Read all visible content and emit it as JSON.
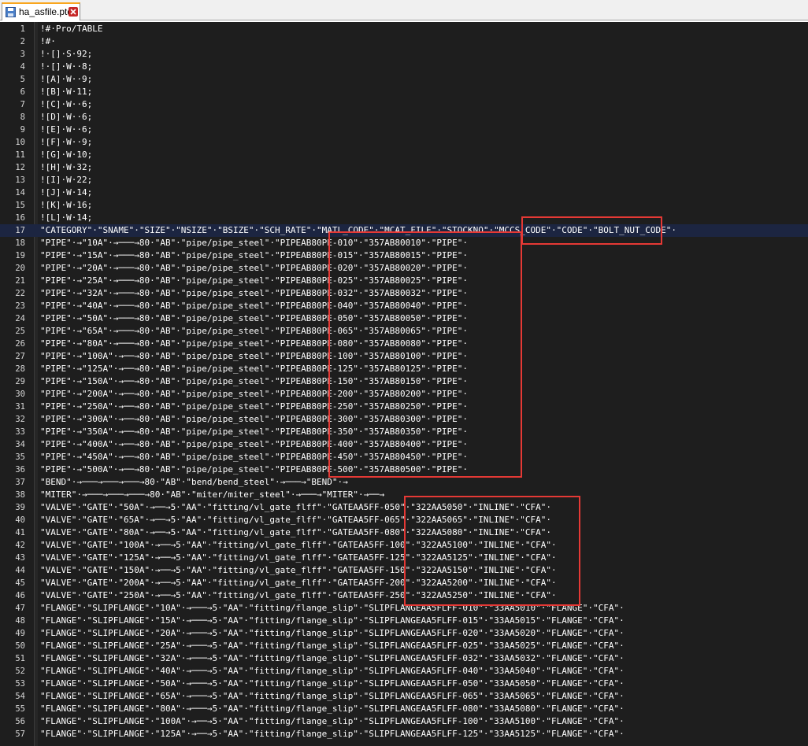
{
  "tab": {
    "filename": "ha_asfile.ptd"
  },
  "icons": {
    "file": "save-file-icon",
    "close": "close-tab-icon"
  },
  "colors": {
    "editor_bg": "#1e1e1e",
    "text": "#ffffff",
    "highlight_box": "#e53935",
    "current_line": "#1c2541",
    "active_tab_accent": "#f9a61e"
  },
  "current_line_number": 17,
  "lines": [
    {
      "n": "1",
      "text": "!#·Pro/TABLE"
    },
    {
      "n": "2",
      "text": "!#·"
    },
    {
      "n": "3",
      "text": "!·[]·S·92;"
    },
    {
      "n": "4",
      "text": "!·[]·W··8;"
    },
    {
      "n": "5",
      "text": "![A]·W··9;"
    },
    {
      "n": "6",
      "text": "![B]·W·11;"
    },
    {
      "n": "7",
      "text": "![C]·W··6;"
    },
    {
      "n": "8",
      "text": "![D]·W··6;"
    },
    {
      "n": "9",
      "text": "![E]·W··6;"
    },
    {
      "n": "10",
      "text": "![F]·W··9;"
    },
    {
      "n": "11",
      "text": "![G]·W·10;"
    },
    {
      "n": "12",
      "text": "![H]·W·32;"
    },
    {
      "n": "13",
      "text": "![I]·W·22;"
    },
    {
      "n": "14",
      "text": "![J]·W·14;"
    },
    {
      "n": "15",
      "text": "![K]·W·16;"
    },
    {
      "n": "16",
      "text": "![L]·W·14;"
    },
    {
      "n": "17",
      "text": "\"CATEGORY\"·\"SNAME\"·\"SIZE\"·\"NSIZE\"·\"BSIZE\"·\"SCH_RATE\"·\"MATL_CODE\"·\"MCAT_FILE\"·\"STOCKNO\"·\"MCCS_CODE\"·\"CODE\"·\"BOLT_NUT_CODE\"·"
    },
    {
      "n": "18",
      "text": "\"PIPE\"·→\"10A\"·→───→80·\"AB\"·\"pipe/pipe_steel\"·\"PIPEAB80PE-010\"·\"357AB80010\"·\"PIPE\"·"
    },
    {
      "n": "19",
      "text": "\"PIPE\"·→\"15A\"·→───→80·\"AB\"·\"pipe/pipe_steel\"·\"PIPEAB80PE-015\"·\"357AB80015\"·\"PIPE\"·"
    },
    {
      "n": "20",
      "text": "\"PIPE\"·→\"20A\"·→───→80·\"AB\"·\"pipe/pipe_steel\"·\"PIPEAB80PE-020\"·\"357AB80020\"·\"PIPE\"·"
    },
    {
      "n": "21",
      "text": "\"PIPE\"·→\"25A\"·→───→80·\"AB\"·\"pipe/pipe_steel\"·\"PIPEAB80PE-025\"·\"357AB80025\"·\"PIPE\"·"
    },
    {
      "n": "22",
      "text": "\"PIPE\"·→\"32A\"·→───→80·\"AB\"·\"pipe/pipe_steel\"·\"PIPEAB80PE-032\"·\"357AB80032\"·\"PIPE\"·"
    },
    {
      "n": "23",
      "text": "\"PIPE\"·→\"40A\"·→───→80·\"AB\"·\"pipe/pipe_steel\"·\"PIPEAB80PE-040\"·\"357AB80040\"·\"PIPE\"·"
    },
    {
      "n": "24",
      "text": "\"PIPE\"·→\"50A\"·→───→80·\"AB\"·\"pipe/pipe_steel\"·\"PIPEAB80PE-050\"·\"357AB80050\"·\"PIPE\"·"
    },
    {
      "n": "25",
      "text": "\"PIPE\"·→\"65A\"·→───→80·\"AB\"·\"pipe/pipe_steel\"·\"PIPEAB80PE-065\"·\"357AB80065\"·\"PIPE\"·"
    },
    {
      "n": "26",
      "text": "\"PIPE\"·→\"80A\"·→───→80·\"AB\"·\"pipe/pipe_steel\"·\"PIPEAB80PE-080\"·\"357AB80080\"·\"PIPE\"·"
    },
    {
      "n": "27",
      "text": "\"PIPE\"·→\"100A\"·→──→80·\"AB\"·\"pipe/pipe_steel\"·\"PIPEAB80PE-100\"·\"357AB80100\"·\"PIPE\"·"
    },
    {
      "n": "28",
      "text": "\"PIPE\"·→\"125A\"·→──→80·\"AB\"·\"pipe/pipe_steel\"·\"PIPEAB80PE-125\"·\"357AB80125\"·\"PIPE\"·"
    },
    {
      "n": "29",
      "text": "\"PIPE\"·→\"150A\"·→──→80·\"AB\"·\"pipe/pipe_steel\"·\"PIPEAB80PE-150\"·\"357AB80150\"·\"PIPE\"·"
    },
    {
      "n": "30",
      "text": "\"PIPE\"·→\"200A\"·→──→80·\"AB\"·\"pipe/pipe_steel\"·\"PIPEAB80PE-200\"·\"357AB80200\"·\"PIPE\"·"
    },
    {
      "n": "31",
      "text": "\"PIPE\"·→\"250A\"·→──→80·\"AB\"·\"pipe/pipe_steel\"·\"PIPEAB80PE-250\"·\"357AB80250\"·\"PIPE\"·"
    },
    {
      "n": "32",
      "text": "\"PIPE\"·→\"300A\"·→──→80·\"AB\"·\"pipe/pipe_steel\"·\"PIPEAB80PE-300\"·\"357AB80300\"·\"PIPE\"·"
    },
    {
      "n": "33",
      "text": "\"PIPE\"·→\"350A\"·→──→80·\"AB\"·\"pipe/pipe_steel\"·\"PIPEAB80PE-350\"·\"357AB80350\"·\"PIPE\"·"
    },
    {
      "n": "34",
      "text": "\"PIPE\"·→\"400A\"·→──→80·\"AB\"·\"pipe/pipe_steel\"·\"PIPEAB80PE-400\"·\"357AB80400\"·\"PIPE\"·"
    },
    {
      "n": "35",
      "text": "\"PIPE\"·→\"450A\"·→──→80·\"AB\"·\"pipe/pipe_steel\"·\"PIPEAB80PE-450\"·\"357AB80450\"·\"PIPE\"·"
    },
    {
      "n": "36",
      "text": "\"PIPE\"·→\"500A\"·→──→80·\"AB\"·\"pipe/pipe_steel\"·\"PIPEAB80PE-500\"·\"357AB80500\"·\"PIPE\"·"
    },
    {
      "n": "37",
      "text": "\"BEND\"·→───→───→───→80·\"AB\"·\"bend/bend_steel\"·→───→\"BEND\"·→"
    },
    {
      "n": "38",
      "text": "\"MITER\"·→───→───→───→80·\"AB\"·\"miter/miter_steel\"·→───→\"MITER\"·→──→"
    },
    {
      "n": "39",
      "text": "\"VALVE\"·\"GATE\"·\"50A\"·→──→5·\"AA\"·\"fitting/vl_gate_flff\"·\"GATEAA5FF-050\"·\"322AA5050\"·\"INLINE\"·\"CFA\"·"
    },
    {
      "n": "40",
      "text": "\"VALVE\"·\"GATE\"·\"65A\"·→──→5·\"AA\"·\"fitting/vl_gate_flff\"·\"GATEAA5FF-065\"·\"322AA5065\"·\"INLINE\"·\"CFA\"·"
    },
    {
      "n": "41",
      "text": "\"VALVE\"·\"GATE\"·\"80A\"·→──→5·\"AA\"·\"fitting/vl_gate_flff\"·\"GATEAA5FF-080\"·\"322AA5080\"·\"INLINE\"·\"CFA\"·"
    },
    {
      "n": "42",
      "text": "\"VALVE\"·\"GATE\"·\"100A\"·→──→5·\"AA\"·\"fitting/vl_gate_flff\"·\"GATEAA5FF-100\"·\"322AA5100\"·\"INLINE\"·\"CFA\"·"
    },
    {
      "n": "43",
      "text": "\"VALVE\"·\"GATE\"·\"125A\"·→──→5·\"AA\"·\"fitting/vl_gate_flff\"·\"GATEAA5FF-125\"·\"322AA5125\"·\"INLINE\"·\"CFA\"·"
    },
    {
      "n": "44",
      "text": "\"VALVE\"·\"GATE\"·\"150A\"·→──→5·\"AA\"·\"fitting/vl_gate_flff\"·\"GATEAA5FF-150\"·\"322AA5150\"·\"INLINE\"·\"CFA\"·"
    },
    {
      "n": "45",
      "text": "\"VALVE\"·\"GATE\"·\"200A\"·→──→5·\"AA\"·\"fitting/vl_gate_flff\"·\"GATEAA5FF-200\"·\"322AA5200\"·\"INLINE\"·\"CFA\"·"
    },
    {
      "n": "46",
      "text": "\"VALVE\"·\"GATE\"·\"250A\"·→──→5·\"AA\"·\"fitting/vl_gate_flff\"·\"GATEAA5FF-250\"·\"322AA5250\"·\"INLINE\"·\"CFA\"·"
    },
    {
      "n": "47",
      "text": "\"FLANGE\"·\"SLIPFLANGE\"·\"10A\"·→───→5·\"AA\"·\"fitting/flange_slip\"·\"SLIPFLANGEAA5FLFF-010\"·\"33AA5010\"·\"FLANGE\"·\"CFA\"·"
    },
    {
      "n": "48",
      "text": "\"FLANGE\"·\"SLIPFLANGE\"·\"15A\"·→───→5·\"AA\"·\"fitting/flange_slip\"·\"SLIPFLANGEAA5FLFF-015\"·\"33AA5015\"·\"FLANGE\"·\"CFA\"·"
    },
    {
      "n": "49",
      "text": "\"FLANGE\"·\"SLIPFLANGE\"·\"20A\"·→───→5·\"AA\"·\"fitting/flange_slip\"·\"SLIPFLANGEAA5FLFF-020\"·\"33AA5020\"·\"FLANGE\"·\"CFA\"·"
    },
    {
      "n": "50",
      "text": "\"FLANGE\"·\"SLIPFLANGE\"·\"25A\"·→───→5·\"AA\"·\"fitting/flange_slip\"·\"SLIPFLANGEAA5FLFF-025\"·\"33AA5025\"·\"FLANGE\"·\"CFA\"·"
    },
    {
      "n": "51",
      "text": "\"FLANGE\"·\"SLIPFLANGE\"·\"32A\"·→───→5·\"AA\"·\"fitting/flange_slip\"·\"SLIPFLANGEAA5FLFF-032\"·\"33AA5032\"·\"FLANGE\"·\"CFA\"·"
    },
    {
      "n": "52",
      "text": "\"FLANGE\"·\"SLIPFLANGE\"·\"40A\"·→───→5·\"AA\"·\"fitting/flange_slip\"·\"SLIPFLANGEAA5FLFF-040\"·\"33AA5040\"·\"FLANGE\"·\"CFA\"·"
    },
    {
      "n": "53",
      "text": "\"FLANGE\"·\"SLIPFLANGE\"·\"50A\"·→───→5·\"AA\"·\"fitting/flange_slip\"·\"SLIPFLANGEAA5FLFF-050\"·\"33AA5050\"·\"FLANGE\"·\"CFA\"·"
    },
    {
      "n": "54",
      "text": "\"FLANGE\"·\"SLIPFLANGE\"·\"65A\"·→───→5·\"AA\"·\"fitting/flange_slip\"·\"SLIPFLANGEAA5FLFF-065\"·\"33AA5065\"·\"FLANGE\"·\"CFA\"·"
    },
    {
      "n": "55",
      "text": "\"FLANGE\"·\"SLIPFLANGE\"·\"80A\"·→───→5·\"AA\"·\"fitting/flange_slip\"·\"SLIPFLANGEAA5FLFF-080\"·\"33AA5080\"·\"FLANGE\"·\"CFA\"·"
    },
    {
      "n": "56",
      "text": "\"FLANGE\"·\"SLIPFLANGE\"·\"100A\"·→──→5·\"AA\"·\"fitting/flange_slip\"·\"SLIPFLANGEAA5FLFF-100\"·\"33AA5100\"·\"FLANGE\"·\"CFA\"·"
    },
    {
      "n": "57",
      "text": "\"FLANGE\"·\"SLIPFLANGE\"·\"125A\"·→──→5·\"AA\"·\"fitting/flange_slip\"·\"SLIPFLANGEAA5FLFF-125\"·\"33AA5125\"·\"FLANGE\"·\"CFA\"·"
    }
  ]
}
